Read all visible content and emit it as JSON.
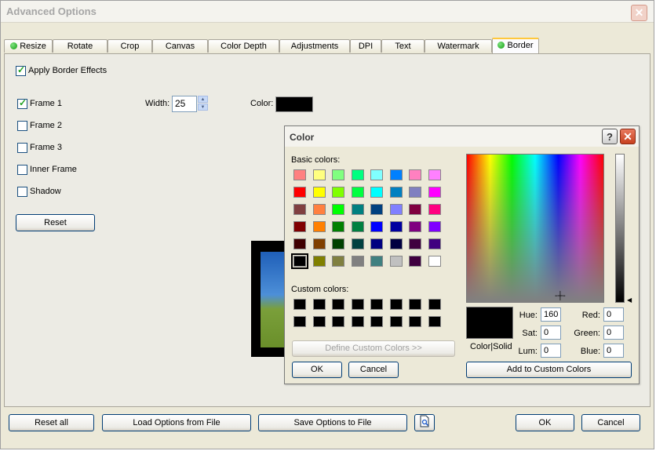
{
  "window": {
    "title": "Advanced Options"
  },
  "tabs": [
    "Resize",
    "Rotate",
    "Crop",
    "Canvas",
    "Color Depth",
    "Adjustments",
    "DPI",
    "Text",
    "Watermark",
    "Border"
  ],
  "border_panel": {
    "apply_label": "Apply Border Effects",
    "frames": [
      "Frame 1",
      "Frame 2",
      "Frame 3",
      "Inner Frame",
      "Shadow"
    ],
    "width_label": "Width:",
    "width_value": "25",
    "color_label": "Color:",
    "color_value": "#000000",
    "reset_label": "Reset"
  },
  "bottom_bar": {
    "reset_all": "Reset all",
    "load": "Load Options from File",
    "save": "Save Options to File",
    "ok": "OK",
    "cancel": "Cancel"
  },
  "color_dialog": {
    "title": "Color",
    "basic_colors_label": "Basic colors:",
    "basic_colors": [
      [
        "#ff8080",
        "#ffff80",
        "#80ff80",
        "#00ff80",
        "#80ffff",
        "#0080ff",
        "#ff80c0",
        "#ff80ff"
      ],
      [
        "#ff0000",
        "#ffff00",
        "#80ff00",
        "#00ff40",
        "#00ffff",
        "#0080c0",
        "#8080c0",
        "#ff00ff"
      ],
      [
        "#804040",
        "#ff8040",
        "#00ff00",
        "#008080",
        "#004080",
        "#8080ff",
        "#800040",
        "#ff0080"
      ],
      [
        "#800000",
        "#ff8000",
        "#008000",
        "#008040",
        "#0000ff",
        "#0000a0",
        "#800080",
        "#8000ff"
      ],
      [
        "#400000",
        "#804000",
        "#004000",
        "#004040",
        "#000080",
        "#000040",
        "#400040",
        "#400080"
      ],
      [
        "#000000",
        "#808000",
        "#808040",
        "#808080",
        "#408080",
        "#c0c0c0",
        "#400040",
        "#ffffff"
      ]
    ],
    "custom_colors_label": "Custom colors:",
    "define_custom": "Define Custom Colors >>",
    "ok": "OK",
    "cancel": "Cancel",
    "color_solid": "Color|Solid",
    "hue_label": "Hue:",
    "hue": "160",
    "sat_label": "Sat:",
    "sat": "0",
    "lum_label": "Lum:",
    "lum": "0",
    "red_label": "Red:",
    "red": "0",
    "green_label": "Green:",
    "green": "0",
    "blue_label": "Blue:",
    "blue": "0",
    "add_custom": "Add to Custom Colors"
  }
}
